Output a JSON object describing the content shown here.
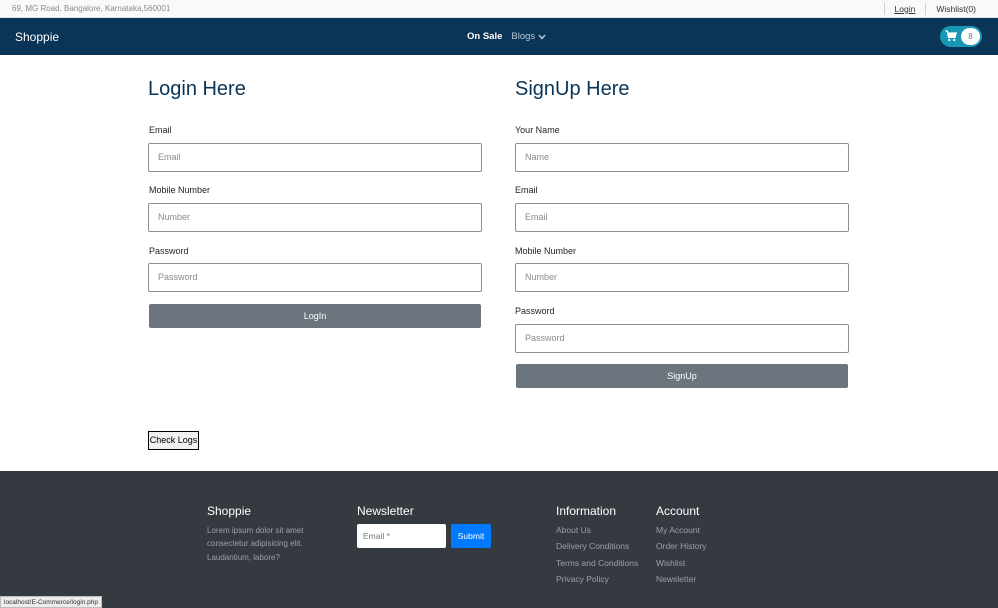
{
  "topbar": {
    "address": "69, MG Road, Bangalore, Karnataka,560001",
    "login_link": "Login",
    "wishlist_link": "Wishlist(0)"
  },
  "navbar": {
    "brand": "Shoppie",
    "links": [
      "On Sale",
      "Blogs"
    ],
    "cart_icon": "cart-icon",
    "cart_count": "8"
  },
  "login": {
    "heading": "Login Here",
    "email_label": "Email",
    "email_placeholder": "Email",
    "mobile_label": "Mobile Number",
    "mobile_placeholder": "Number",
    "password_label": "Password",
    "password_placeholder": "Password",
    "button": "LogIn"
  },
  "signup": {
    "heading": "SignUp Here",
    "name_label": "Your Name",
    "name_placeholder": "Name",
    "email_label": "Email",
    "email_placeholder": "Email",
    "mobile_label": "Mobile Number",
    "mobile_placeholder": "Number",
    "password_label": "Password",
    "password_placeholder": "Password",
    "button": "SignUp"
  },
  "check_logs_button": "Check Logs",
  "footer": {
    "brand": "Shoppie",
    "brand_text_lines": [
      "Lorem ipsum dolor sit amet",
      "consectetur adipisicing elit.",
      "Laudantium, labore?"
    ],
    "newsletter_heading": "Newsletter",
    "newsletter_placeholder": "Email *",
    "newsletter_submit": "Submit",
    "information_heading": "Information",
    "information_links": [
      "About Us",
      "Delivery Conditions",
      "Terms and Conditions",
      "Privacy Policy"
    ],
    "account_heading": "Account",
    "account_links": [
      "My Account",
      "Order History",
      "Wishlist",
      "Newsletter"
    ]
  },
  "status_url": "localhost/E-Commerce/login.php",
  "colors": {
    "navbar": "#0a3557",
    "cart_pill": "#1997b5",
    "button_gray": "#6c757d",
    "footer": "#343a40",
    "submit_blue": "#007bff"
  }
}
